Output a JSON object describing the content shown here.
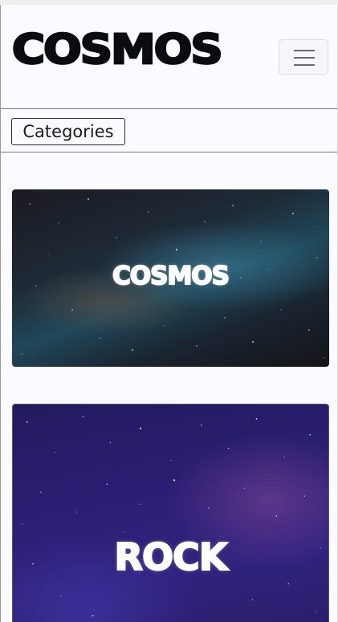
{
  "header": {
    "brand": "COSMOS",
    "menu_icon": "hamburger-menu-icon"
  },
  "nav": {
    "categories_label": "Categories"
  },
  "cards": [
    {
      "title": "COSMOS",
      "image": "milky-way-night-sky"
    },
    {
      "title": "ROCK",
      "image": "purple-starfield"
    }
  ],
  "colors": {
    "page_background": "#fbfaff",
    "brand_text": "#0b0b12",
    "card_title": "#ffffff"
  }
}
